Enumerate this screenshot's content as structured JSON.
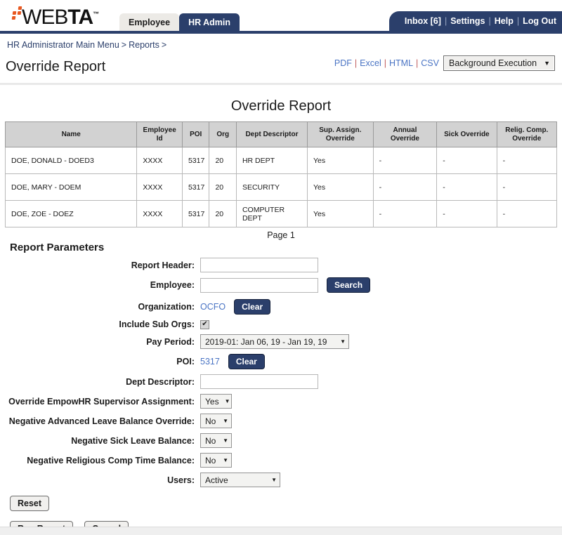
{
  "header": {
    "logo_text_light": "WEB",
    "logo_text_bold": "TA",
    "logo_tm": "™",
    "tabs": [
      {
        "label": "Employee",
        "active": false
      },
      {
        "label": "HR Admin",
        "active": true
      }
    ],
    "usernav": [
      {
        "label": "Inbox [6]"
      },
      {
        "label": "Settings"
      },
      {
        "label": "Help"
      },
      {
        "label": "Log Out"
      }
    ],
    "usernav_separator": "|",
    "accent_navy": "#2b3f6b",
    "accent_orange": "#e8571f",
    "link_blue": "#4a74c4"
  },
  "breadcrumb": {
    "items": [
      {
        "label": "HR Administrator Main Menu"
      },
      {
        "label": "Reports"
      }
    ],
    "caret": ">"
  },
  "page": {
    "title": "Override Report"
  },
  "exports": {
    "links": [
      {
        "label": "PDF"
      },
      {
        "label": "Excel"
      },
      {
        "label": "HTML"
      },
      {
        "label": "CSV"
      }
    ],
    "separator": "|",
    "execution_mode": "Background Execution",
    "arrow": "▼"
  },
  "report": {
    "title": "Override Report",
    "columns": [
      "Name",
      "Employee Id",
      "POI",
      "Org",
      "Dept Descriptor",
      "Sup. Assign. Override",
      "Annual Override",
      "Sick Override",
      "Relig. Comp. Override"
    ],
    "rows": [
      {
        "name": "DOE, DONALD - DOED3",
        "employee_id": "XXXX",
        "poi": "5317",
        "org": "20",
        "dept_descriptor": "HR DEPT",
        "sup_assign_override": "Yes",
        "annual_override": "-",
        "sick_override": "-",
        "relig_comp_override": "-"
      },
      {
        "name": "DOE, MARY - DOEM",
        "employee_id": "XXXX",
        "poi": "5317",
        "org": "20",
        "dept_descriptor": "SECURITY",
        "sup_assign_override": "Yes",
        "annual_override": "-",
        "sick_override": "-",
        "relig_comp_override": "-"
      },
      {
        "name": "DOE, ZOE - DOEZ",
        "employee_id": "XXXX",
        "poi": "5317",
        "org": "20",
        "dept_descriptor": "COMPUTER DEPT",
        "sup_assign_override": "Yes",
        "annual_override": "-",
        "sick_override": "-",
        "relig_comp_override": "-"
      }
    ],
    "page_label": "Page 1"
  },
  "params": {
    "heading": "Report Parameters",
    "report_header": {
      "label": "Report Header:",
      "value": "",
      "placeholder": ""
    },
    "employee": {
      "label": "Employee:",
      "value": "",
      "placeholder": "",
      "search_button": "Search"
    },
    "organization": {
      "label": "Organization:",
      "value": "OCFO",
      "clear_button": "Clear"
    },
    "include_sub_orgs": {
      "label": "Include Sub Orgs:",
      "checked": true,
      "check_glyph": "✔"
    },
    "pay_period": {
      "label": "Pay Period:",
      "value": "2019-01: Jan 06, 19 - Jan 19, 19",
      "arrow": "▼"
    },
    "poi": {
      "label": "POI:",
      "value": "5317",
      "clear_button": "Clear"
    },
    "dept_descriptor": {
      "label": "Dept Descriptor:",
      "value": "",
      "placeholder": ""
    },
    "override_empowhr": {
      "label": "Override EmpowHR Supervisor Assignment:",
      "value": "Yes",
      "arrow": "▼"
    },
    "neg_advanced_leave": {
      "label": "Negative Advanced Leave Balance Override:",
      "value": "No",
      "arrow": "▼"
    },
    "neg_sick_leave": {
      "label": "Negative Sick Leave Balance:",
      "value": "No",
      "arrow": "▼"
    },
    "neg_relig_comp": {
      "label": "Negative Religious Comp Time Balance:",
      "value": "No",
      "arrow": "▼"
    },
    "users": {
      "label": "Users:",
      "value": "Active",
      "arrow": "▼"
    }
  },
  "actions": {
    "reset": "Reset",
    "run_report": "Run Report",
    "cancel": "Cancel"
  }
}
